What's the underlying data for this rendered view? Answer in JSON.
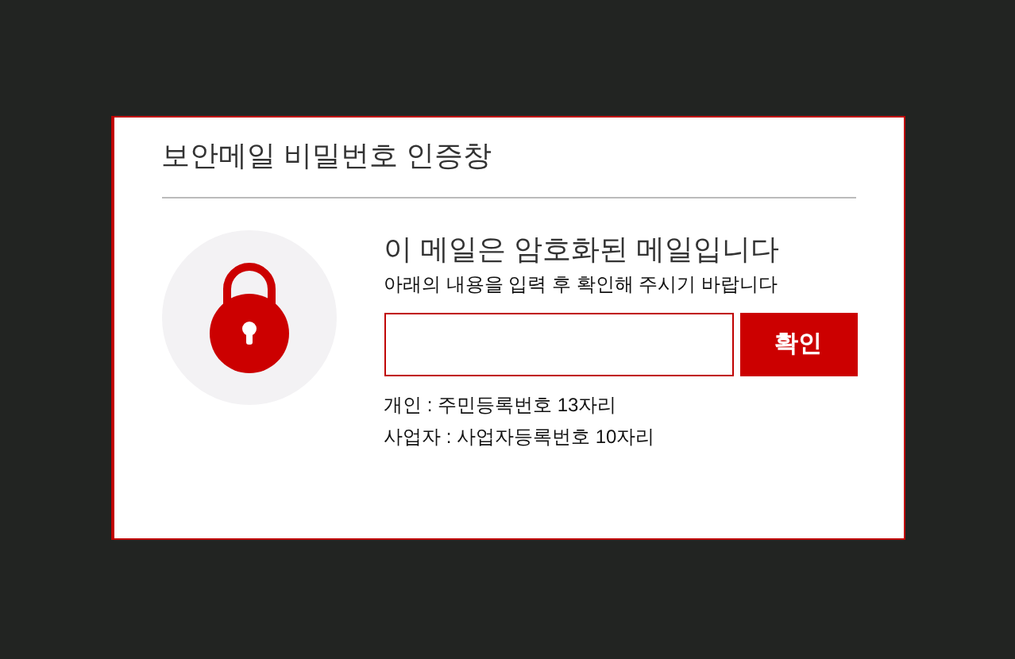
{
  "dialog": {
    "title": "보안메일 비밀번호 인증창"
  },
  "message": {
    "heading": "이 메일은 암호화된 메일입니다",
    "instruction": "아래의 내용을 입력 후 확인해 주시기 바랍니다"
  },
  "password": {
    "button": "확인"
  },
  "hints": [
    "개인 : 주민등록번호 13자리",
    "사업자 : 사업자등록번호 10자리"
  ]
}
